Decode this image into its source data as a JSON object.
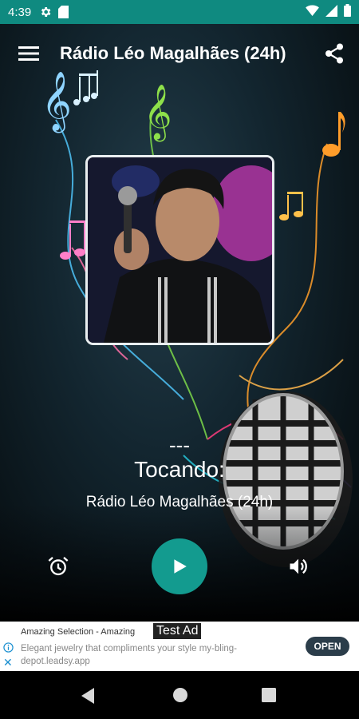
{
  "status_bar": {
    "time": "4:39",
    "icons": [
      "gear-icon",
      "sd-card-icon",
      "wifi-icon",
      "signal-icon",
      "battery-icon"
    ],
    "color": "#0f8a80"
  },
  "toolbar": {
    "title": "Rádio Léo Magalhães (24h)",
    "menu_icon": "hamburger-menu-icon",
    "share_icon": "share-icon"
  },
  "now_playing": {
    "dashes": "---",
    "label": "Tocando:",
    "station": "Rádio Léo Magalhães (24h)"
  },
  "controls": {
    "alarm_icon": "alarm-icon",
    "play_icon": "play-icon",
    "volume_icon": "volume-icon",
    "play_color": "#139b8f"
  },
  "ad": {
    "title": "Amazing Selection - Amazing",
    "test_label": "Test Ad",
    "description": "Elegant jewelry that compliments your style my-bling-depot.leadsy.app",
    "open_label": "OPEN"
  },
  "nav_bar": {
    "icons": [
      "back-icon",
      "home-icon",
      "recents-icon"
    ]
  }
}
